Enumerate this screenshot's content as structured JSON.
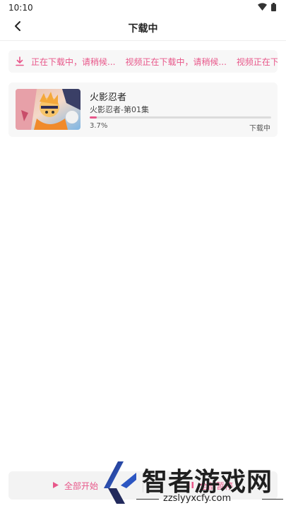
{
  "status_bar": {
    "time": "10:10",
    "icons": [
      "wifi-icon",
      "battery-icon"
    ]
  },
  "header": {
    "title": "下载中",
    "back_icon": "chevron-left-icon"
  },
  "notice": {
    "icon": "download-icon",
    "messages": [
      "视频正在下载中，请稍候...",
      "视频正在下载中，请稍候...",
      "视频正在下载中，请稍候..."
    ],
    "color": "#e8578a"
  },
  "downloads": [
    {
      "title": "火影忍者",
      "episode": "火影忍者-第01集",
      "progress_text": "3.7%",
      "progress": 0.037,
      "status": "下载中"
    }
  ],
  "bottom_bar": {
    "start_all_label": "全部开始",
    "pause_all_label": "全部暂停",
    "start_icon": "play-icon",
    "pause_icon": "pause-icon"
  },
  "watermark": {
    "title": "智者游戏网",
    "url": "zzslyyxcfy.com"
  },
  "colors": {
    "accent": "#e8578a",
    "card_bg": "#f7f7f7"
  }
}
